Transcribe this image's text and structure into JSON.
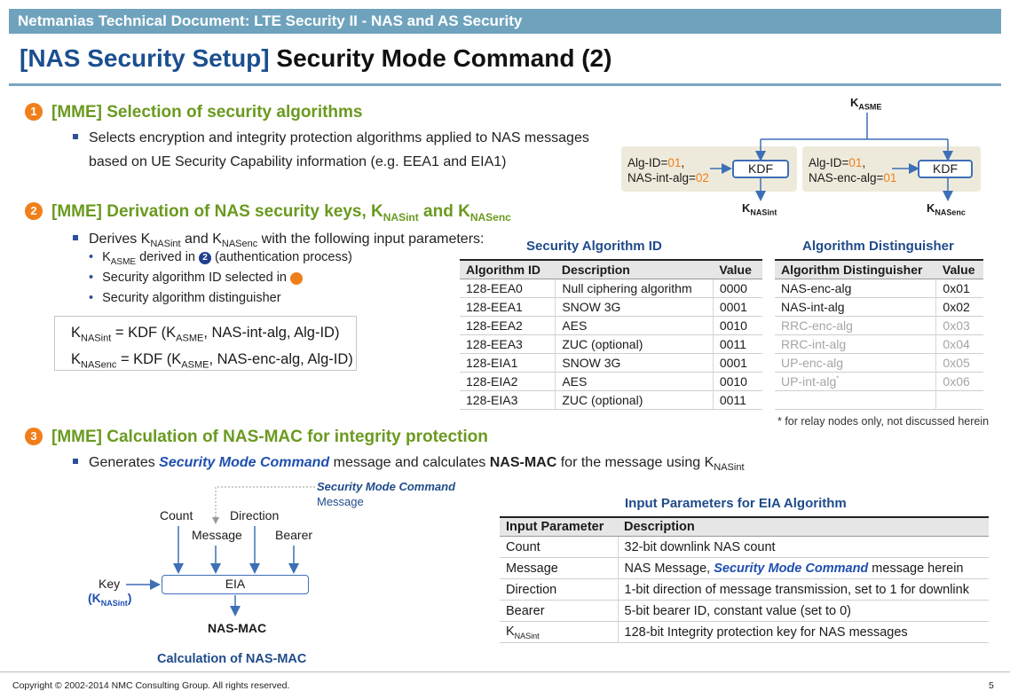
{
  "header": "Netmanias Technical Document: LTE Security II - NAS and AS Security",
  "title": {
    "lead": "[NAS Security Setup]",
    "rest": "Security Mode Command (2)"
  },
  "section1": {
    "num": "1",
    "heading": "[MME] Selection of security algorithms",
    "bullet_line1": "Selects encryption and integrity protection algorithms applied to NAS messages",
    "bullet_line2": "based on UE Security Capability information (e.g. EEA1 and EIA1)"
  },
  "section2": {
    "num": "2",
    "heading_a": "[MME] Derivation of NAS security keys, K",
    "heading_sub1": "NASint",
    "heading_b": " and K",
    "heading_sub2": "NASenc",
    "bullet": {
      "a": "Derives K",
      "s1": "NASint",
      "b": " and K",
      "s2": "NASenc",
      "c": " with the following input parameters:"
    },
    "sub1": {
      "a": "K",
      "s": "ASME",
      "b": " derived in ",
      "num": "2",
      "c": " (authentication process)"
    },
    "sub2": {
      "a": "Security algorithm ID selected in ",
      "num": "1"
    },
    "sub3": "Security algorithm distinguisher",
    "f1": {
      "k": "K",
      "ks": "NASint",
      "eq": " = KDF (K",
      "as": "ASME",
      "rest": ", NAS-int-alg, Alg-ID)"
    },
    "f2": {
      "k": "K",
      "ks": "NASenc",
      "eq": " = KDF (K",
      "as": "ASME",
      "rest": ", NAS-enc-alg, Alg-ID)"
    }
  },
  "kdf_diagram": {
    "top_k": "K",
    "top_sub": "ASME",
    "left": {
      "alg": "Alg-ID=",
      "alg_val": "01",
      "comma": ",",
      "p": "NAS-int-alg=",
      "p_val": "02",
      "box": "KDF",
      "out": "K",
      "out_sub": "NASint"
    },
    "right": {
      "alg": "Alg-ID=",
      "alg_val": "01",
      "comma": ",",
      "p": "NAS-enc-alg=",
      "p_val": "01",
      "box": "KDF",
      "out": "K",
      "out_sub": "NASenc"
    }
  },
  "alg_table": {
    "caption": "Security Algorithm ID",
    "headers": [
      "Algorithm ID",
      "Description",
      "Value"
    ],
    "rows": [
      [
        "128-EEA0",
        "Null ciphering algorithm",
        "0000"
      ],
      [
        "128-EEA1",
        "SNOW 3G",
        "0001"
      ],
      [
        "128-EEA2",
        "AES",
        "0010"
      ],
      [
        "128-EEA3",
        "ZUC (optional)",
        "0011"
      ],
      [
        "128-EIA1",
        "SNOW 3G",
        "0001"
      ],
      [
        "128-EIA2",
        "AES",
        "0010"
      ],
      [
        "128-EIA3",
        "ZUC (optional)",
        "0011"
      ]
    ]
  },
  "dist_table": {
    "caption": "Algorithm Distinguisher",
    "headers": [
      "Algorithm Distinguisher",
      "Value"
    ],
    "rows": [
      [
        "NAS-enc-alg",
        "0x01"
      ],
      [
        "NAS-int-alg",
        "0x02"
      ],
      [
        "RRC-enc-alg",
        "0x03"
      ],
      [
        "RRC-int-alg",
        "0x04"
      ],
      [
        "UP-enc-alg",
        "0x05"
      ],
      [
        "UP-int-alg",
        "0x06"
      ]
    ],
    "star": "*",
    "note": "* for relay nodes only, not discussed herein"
  },
  "section3": {
    "num": "3",
    "heading": "[MME] Calculation of NAS-MAC for integrity protection",
    "bullet": {
      "a": "Generates ",
      "smc": "Security Mode Command",
      "b": " message and calculates ",
      "mac": "NAS-MAC",
      "c": " for the message using K",
      "s": "NASint"
    }
  },
  "eia_diagram": {
    "smc": "Security Mode Command",
    "message_word": "Message",
    "count": "Count",
    "direction": "Direction",
    "message": "Message",
    "bearer": "Bearer",
    "key": "Key",
    "key_k": "(K",
    "key_sub": "NASint",
    "key_close": ")",
    "eia": "EIA",
    "out": "NAS-MAC",
    "caption": "Calculation of NAS-MAC"
  },
  "eia_table": {
    "caption": "Input Parameters for EIA Algorithm",
    "headers": [
      "Input Parameter",
      "Description"
    ],
    "r1": [
      "Count",
      "32-bit downlink NAS count"
    ],
    "r2": {
      "p": "Message",
      "a": "NAS Message,  ",
      "smc": "Security Mode Command",
      "b": " message herein"
    },
    "r3": [
      "Direction",
      "1-bit direction of message transmission, set to 1 for downlink"
    ],
    "r4": [
      "Bearer",
      "5-bit bearer ID, constant value (set to 0)"
    ],
    "r5": {
      "k": "K",
      "s": "NASint",
      "d": "128-bit Integrity protection key for NAS messages"
    }
  },
  "footer": {
    "copyright": "Copyright © 2002-2014 NMC Consulting Group. All rights reserved.",
    "page": "5"
  },
  "colors": {
    "header_bg": "#6fa3bd",
    "title_blue": "#1b4f8f",
    "green": "#6a9a1f",
    "orange": "#f07f1b",
    "navy": "#1f3f8f",
    "line_blue": "#3d6fb6"
  }
}
